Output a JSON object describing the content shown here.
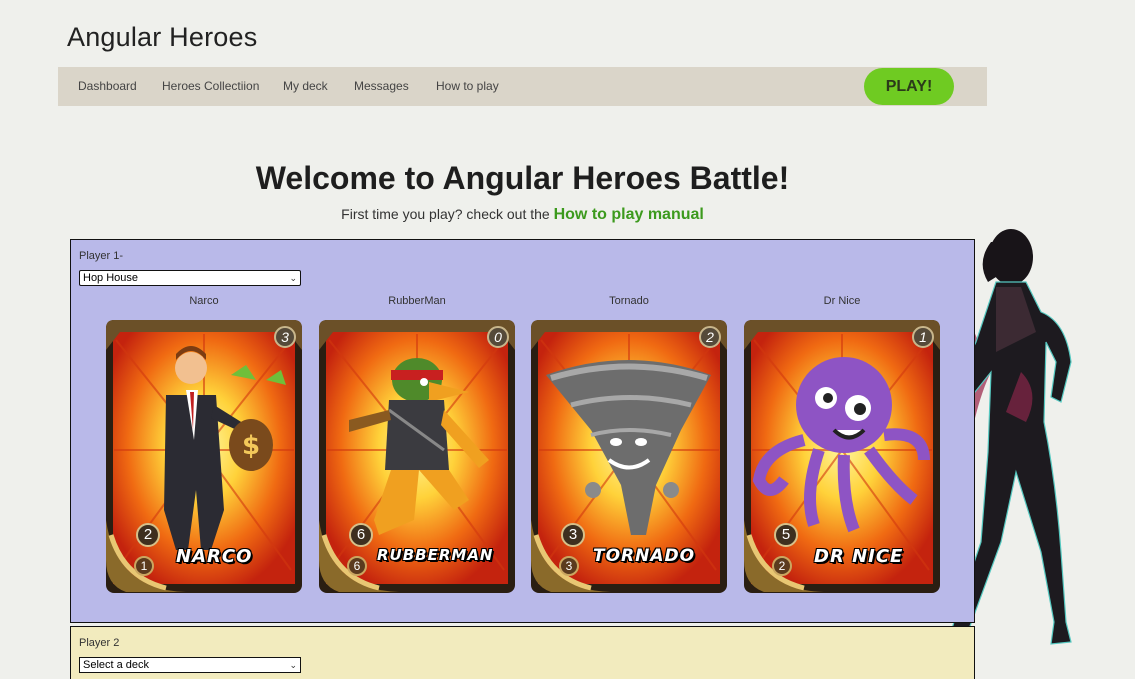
{
  "app": {
    "title": "Angular Heroes"
  },
  "nav": {
    "items": [
      {
        "label": "Dashboard"
      },
      {
        "label": "Heroes Collectiion"
      },
      {
        "label": "My deck"
      },
      {
        "label": "Messages"
      },
      {
        "label": "How to play"
      }
    ],
    "play_label": "PLAY!"
  },
  "welcome": {
    "heading": "Welcome to Angular Heroes Battle!",
    "intro": "First time you play? check out the",
    "manual_link": "How to play manual"
  },
  "player1": {
    "label": "Player 1-",
    "deck_selected": "Hop House",
    "cards": [
      {
        "name": "Narco",
        "art_title": "NARCO",
        "cost": "3",
        "attack": "2",
        "health": "1",
        "icon": "businessman-money-bag-icon"
      },
      {
        "name": "RubberMan",
        "art_title": "RUBBERMAN",
        "cost": "0",
        "attack": "6",
        "health": "6",
        "icon": "ninja-duck-icon"
      },
      {
        "name": "Tornado",
        "art_title": "TORNADO",
        "cost": "2",
        "attack": "3",
        "health": "3",
        "icon": "tornado-icon"
      },
      {
        "name": "Dr Nice",
        "art_title": "DR NICE",
        "cost": "1",
        "attack": "5",
        "health": "2",
        "icon": "octopus-icon"
      }
    ]
  },
  "player2": {
    "label": "Player 2",
    "deck_selected": "Select a deck"
  },
  "colors": {
    "play_button": "#6fcb22",
    "manual_link": "#3c9a1d",
    "player1_bg": "#b9b9e9",
    "player2_bg": "#f2ebbe",
    "navbar_bg": "#dad5c9"
  }
}
